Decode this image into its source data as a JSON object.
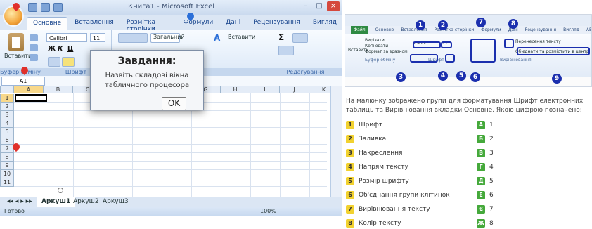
{
  "excel": {
    "window_title": "Книга1 - Microsoft Excel",
    "tabs": [
      "Основне",
      "Вставлення",
      "Розмітка сторінки",
      "Формули",
      "Дані",
      "Рецензування",
      "Вигляд"
    ],
    "ribbon": {
      "paste_label": "Вставити",
      "font_name": "Calibri",
      "font_size": "11",
      "bold": "Ж",
      "italic": "К",
      "underline": "Ц",
      "wrap_text": "Загальний",
      "insert_label": "Вставити",
      "clipboard_group": "Буфер обміну",
      "font_group": "Шрифт",
      "editing_group": "Редагування",
      "sum_symbol": "Σ",
      "font_a": "A"
    },
    "name_box": "A1",
    "columns": [
      "A",
      "B",
      "C",
      "D",
      "E",
      "F",
      "G",
      "H",
      "I",
      "J",
      "K"
    ],
    "rows": [
      "1",
      "2",
      "3",
      "4",
      "5",
      "6",
      "7",
      "8",
      "9",
      "10",
      "11"
    ],
    "sheets": [
      "Аркуш1",
      "Аркуш2",
      "Аркуш3"
    ],
    "status": "Готово",
    "zoom": "100%",
    "dialog": {
      "title": "Завдання:",
      "text": "Назвіть складові вікна табличного процесора",
      "ok": "OK"
    }
  },
  "reference": {
    "tabs": [
      "Файл",
      "Основне",
      "Вставлення",
      "Розмітка сторінки",
      "Формули",
      "Дані",
      "Рецензування",
      "Вигляд",
      "ABBYY FineReader 12"
    ],
    "clipboard": [
      "Вирізати",
      "Копіювати",
      "Формат за зразком"
    ],
    "paste": "Вставити",
    "font_name": "Calibri",
    "font_size": "11",
    "group_clipboard": "Буфер обміну",
    "group_font": "Шрифт",
    "group_align": "Вирівнювання",
    "wrap": "Перенесення тексту",
    "merge": "Об'єднати та розмістити в центрі",
    "numbers": [
      "1",
      "2",
      "3",
      "4",
      "5",
      "6",
      "7",
      "8",
      "9"
    ]
  },
  "question": "На малюнку зображено групи для форматування Шрифт електронних таблиць та Вирівнювання вкладки Основне. Якою цифрою позначено:",
  "options": [
    {
      "num": "1",
      "text": "Шрифт",
      "letter": "А",
      "value": "1"
    },
    {
      "num": "2",
      "text": "Заливка",
      "letter": "Б",
      "value": "2"
    },
    {
      "num": "3",
      "text": "Накреслення",
      "letter": "В",
      "value": "3"
    },
    {
      "num": "4",
      "text": "Напрям тексту",
      "letter": "Г",
      "value": "4"
    },
    {
      "num": "5",
      "text": "Розмір шрифту",
      "letter": "Д",
      "value": "5"
    },
    {
      "num": "6",
      "text": "Об'єднання групи клітинок",
      "letter": "Е",
      "value": "6"
    },
    {
      "num": "7",
      "text": "Вирівнювання тексту",
      "letter": "Є",
      "value": "7"
    },
    {
      "num": "8",
      "text": "Колір тексту",
      "letter": "Ж",
      "value": "8"
    }
  ]
}
